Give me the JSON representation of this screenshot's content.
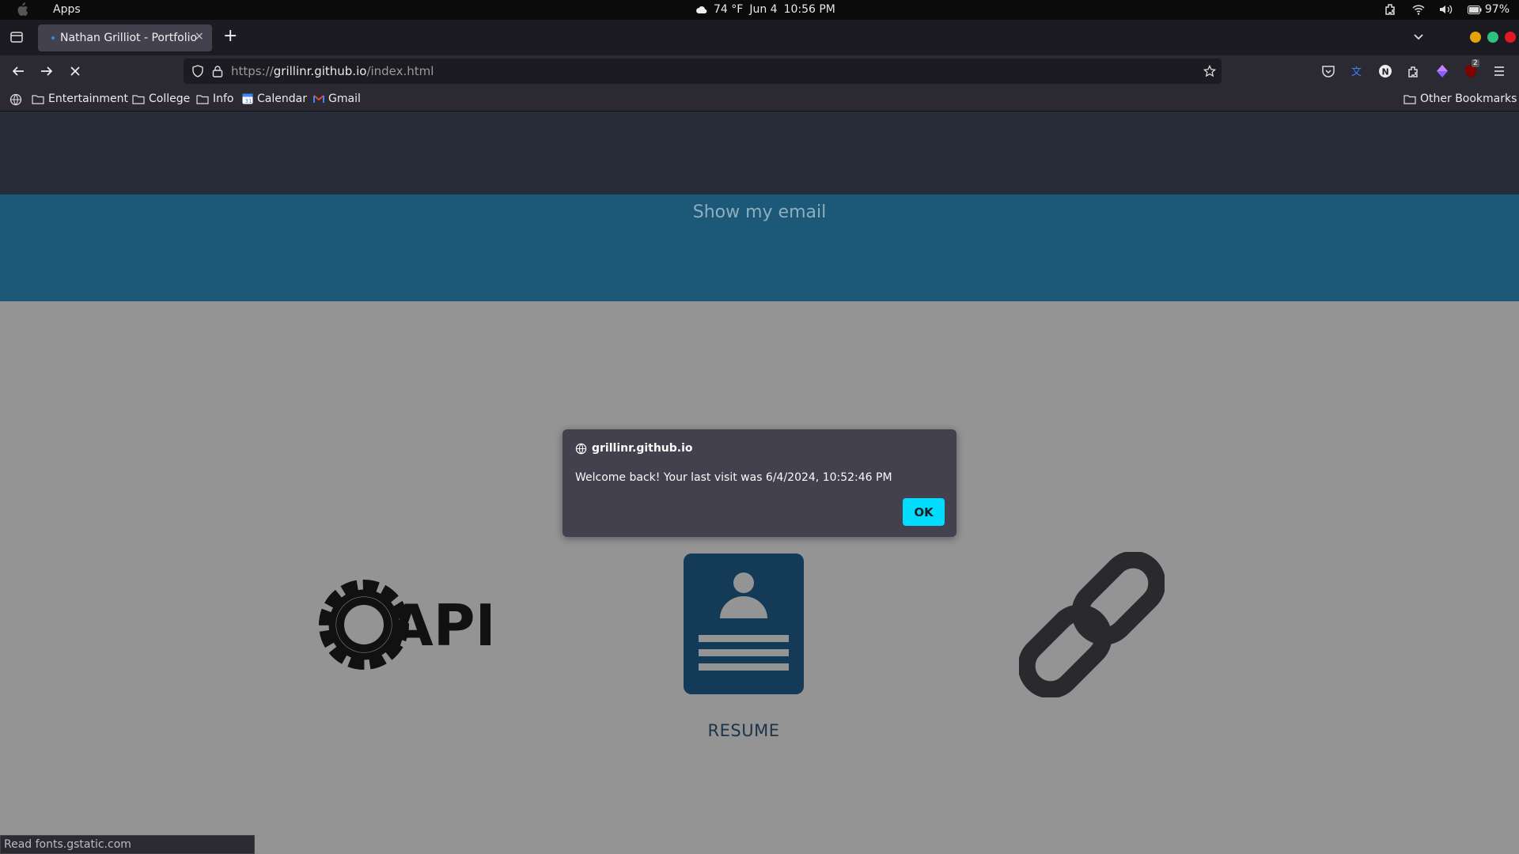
{
  "os_bar": {
    "apps_label": "Apps",
    "weather": "74 °F",
    "date": "Jun 4",
    "time": "10:56 PM",
    "battery": "97%"
  },
  "tab": {
    "title": "Nathan Grilliot - Portfolio",
    "close_glyph": "×",
    "new_tab_glyph": "+"
  },
  "url": {
    "prefix": "https://",
    "domain": "grillinr.github.io",
    "path": "/index.html"
  },
  "bookmarks": {
    "items": [
      "Entertainment",
      "College",
      "Info",
      "Calendar",
      "Gmail"
    ],
    "other": "Other Bookmarks"
  },
  "extensions": {
    "badge_count": "2"
  },
  "page": {
    "email_link": "Show my email",
    "resume_label": "RESUME",
    "api_text": "API"
  },
  "dialog": {
    "origin": "grillinr.github.io",
    "message": "Welcome back! Your last visit was 6/4/2024, 10:52:46 PM",
    "ok_label": "OK"
  },
  "status": "Read fonts.gstatic.com",
  "colors": {
    "header": "#262d39",
    "email_band": "#1c5978",
    "content_bg": "#949494",
    "resume_card": "#133a57",
    "ok_button": "#00ddff"
  }
}
